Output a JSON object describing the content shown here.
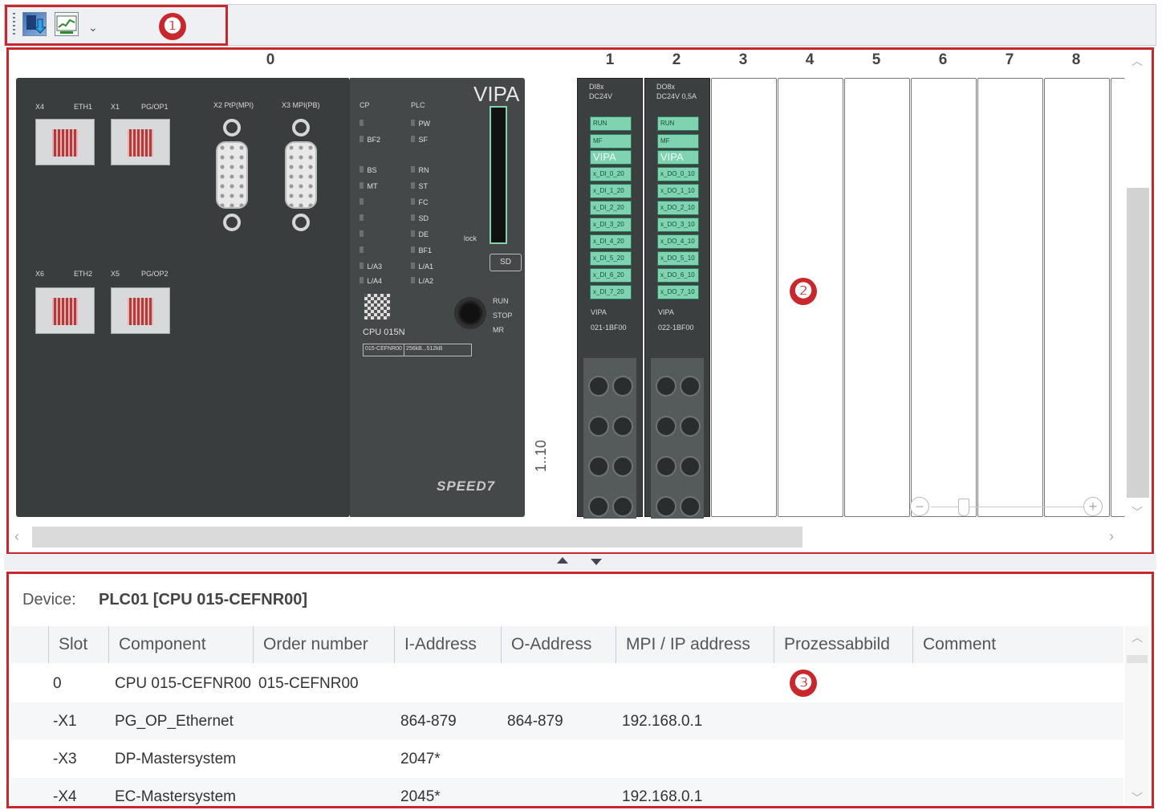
{
  "callouts": {
    "one": "❶",
    "two": "❷",
    "three": "❸"
  },
  "toolbar": {
    "icons": [
      "download-to-plc-icon",
      "monitor-chart-icon"
    ],
    "overflow_glyph": "⌄"
  },
  "rack": {
    "cpu_slot_label": "0",
    "module_slot_labels": [
      "1",
      "2",
      "3",
      "4",
      "5",
      "6",
      "7",
      "8"
    ],
    "side_label": "1..10",
    "cpu": {
      "brand": "VIPA",
      "port_labels_top": [
        "X4",
        "ETH1",
        "X1",
        "PG/OP1",
        "X2 PtP(MPI)",
        "X3 MPI(PB)"
      ],
      "port_labels_bottom": [
        "X6",
        "ETH2",
        "X5",
        "PG/OP2"
      ],
      "led_groups": {
        "cp_header": "CP",
        "plc_header": "PLC",
        "cp_leds": [
          "",
          "BF2",
          "",
          "BS",
          "MT",
          "",
          "",
          "",
          "",
          "L/A3",
          "L/A4"
        ],
        "plc_leds": [
          "PW",
          "SF",
          "",
          "RN",
          "ST",
          "FC",
          "SD",
          "DE",
          "BF1",
          "L/A1",
          "L/A2"
        ]
      },
      "model": "CPU 015N",
      "order_box_1": "015-CEFNR00",
      "order_box_2": "256kB...512kB",
      "switch_labels": [
        "RUN",
        "STOP",
        "MR"
      ],
      "card_label": "SD",
      "lock_label": "lock",
      "logo_text": "SPEED7"
    },
    "modules": [
      {
        "type_line1": "DI8x",
        "type_line2": "DC24V",
        "status": [
          "RUN",
          "MF"
        ],
        "brand": "VIPA",
        "order": "021-1BF00",
        "channels": [
          "x_DI_0_20",
          "x_DI_1_20",
          "x_DI_2_20",
          "x_DI_3_20",
          "x_DI_4_20",
          "x_DI_5_20",
          "x_DI_6_20",
          "x_DI_7_20"
        ]
      },
      {
        "type_line1": "DO8x",
        "type_line2": "DC24V 0,5A",
        "status": [
          "RUN",
          "MF"
        ],
        "brand": "VIPA",
        "order": "022-1BF00",
        "channels": [
          "x_DO_0_10",
          "x_DO_1_10",
          "x_DO_2_10",
          "x_DO_3_10",
          "x_DO_4_10",
          "x_DO_5_10",
          "x_DO_6_10",
          "x_DO_7_10"
        ]
      }
    ]
  },
  "zoom": {
    "minus": "−",
    "plus": "+"
  },
  "device": {
    "label": "Device:",
    "value": "PLC01 [CPU 015-CEFNR00]"
  },
  "table": {
    "headers": [
      "Slot",
      "Component",
      "Order number",
      "I-Address",
      "O-Address",
      "MPI / IP address",
      "Prozessabbild",
      "Comment"
    ],
    "rows": [
      {
        "slot": "0",
        "component": "CPU 015-CEFNR00",
        "order": "015-CEFNR00",
        "i_addr": "",
        "o_addr": "",
        "mpi_ip": "",
        "pa": "",
        "comment": ""
      },
      {
        "slot": "-X1",
        "component": "PG_OP_Ethernet",
        "order": "",
        "i_addr": "864-879",
        "o_addr": "864-879",
        "mpi_ip": "192.168.0.1",
        "pa": "",
        "comment": ""
      },
      {
        "slot": "-X3",
        "component": "DP-Mastersystem",
        "order": "",
        "i_addr": "2047*",
        "o_addr": "",
        "mpi_ip": "",
        "pa": "",
        "comment": ""
      },
      {
        "slot": "-X4",
        "component": "EC-Mastersystem",
        "order": "",
        "i_addr": "2045*",
        "o_addr": "",
        "mpi_ip": "192.168.0.1",
        "pa": "",
        "comment": ""
      }
    ]
  },
  "colors": {
    "callout": "#c8272d",
    "module_green": "#7fd3b0",
    "cpu_body": "#3a3d3e"
  }
}
